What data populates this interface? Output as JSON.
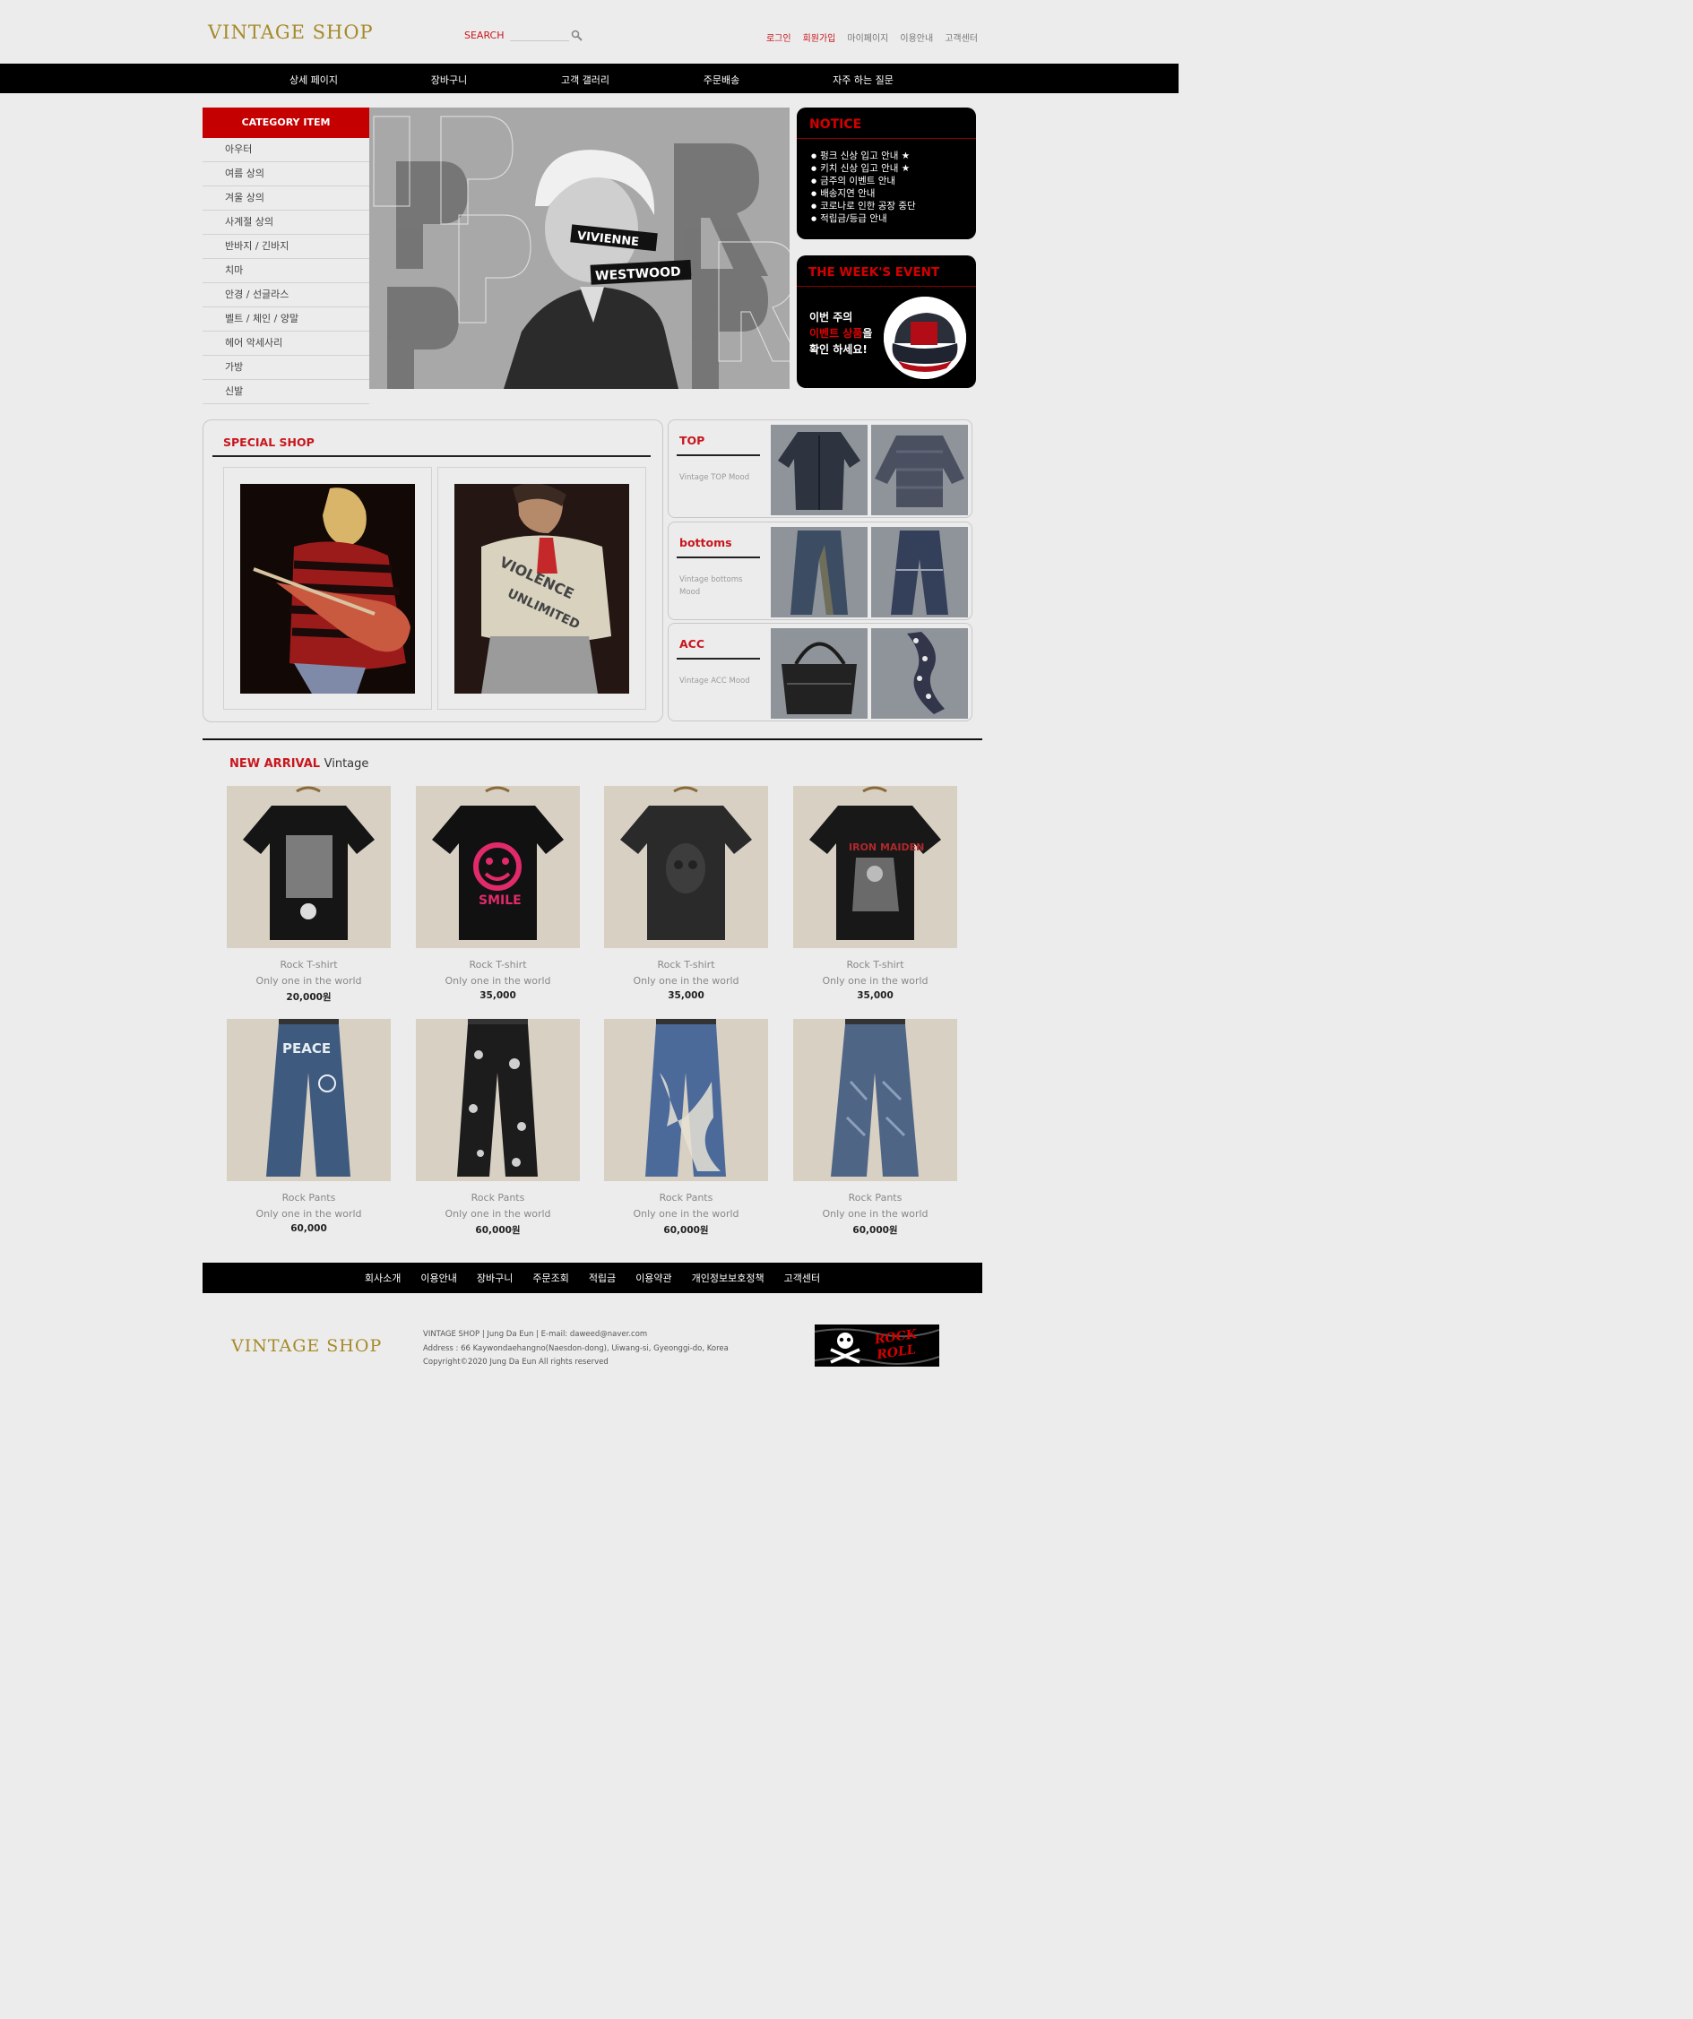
{
  "header": {
    "logo": "VINTAGE SHOP",
    "search_label": "SEARCH",
    "search_placeholder": "",
    "top_links": [
      {
        "label": "로그인"
      },
      {
        "label": "회원가입"
      },
      {
        "label": "마이페이지"
      },
      {
        "label": "이용안내"
      },
      {
        "label": "고객센터"
      }
    ]
  },
  "nav": [
    "상세 페이지",
    "장바구니",
    "고객 갤러리",
    "주문배송",
    "자주 하는 질문"
  ],
  "category": {
    "title": "CATEGORY ITEM",
    "items": [
      "아우터",
      "여름 상의",
      "겨울 상의",
      "사계절 상의",
      "반바지 / 긴바지",
      "치마",
      "안경 / 선글라스",
      "벨트 / 체인 / 양말",
      "헤어 악세사리",
      "가방",
      "신발"
    ]
  },
  "notice": {
    "title": "NOTICE",
    "items": [
      "펑크 신상 입고 안내 ★",
      "키치 신상 입고 안내 ★",
      "금주의 이벤트 안내",
      "배송지연 안내",
      "코로나로 인한 공장 중단",
      "적립금/등급 안내"
    ]
  },
  "event": {
    "title": "THE WEEK'S EVENT",
    "line1": "이번 주의",
    "line2": "이벤트 상품",
    "line2_suffix": "을",
    "line3": "확인 하세요!"
  },
  "special": {
    "title": "SPECIAL SHOP"
  },
  "category_boxes": [
    {
      "title": "TOP",
      "sub": "Vintage TOP Mood"
    },
    {
      "title": "bottoms",
      "sub": "Vintage bottoms Mood"
    },
    {
      "title": "ACC",
      "sub": "Vintage ACC Mood"
    }
  ],
  "new_arrival": {
    "title_red": "NEW ARRIVAL",
    "title_rest": "Vintage",
    "products": [
      {
        "name": "Rock T-shirt",
        "desc": "Only one in the world",
        "price": "20,000원",
        "icon": "tshirt-band-print"
      },
      {
        "name": "Rock T-shirt",
        "desc": "Only one in the world",
        "price": "35,000",
        "icon": "tshirt-smile-print"
      },
      {
        "name": "Rock T-shirt",
        "desc": "Only one in the world",
        "price": "35,000",
        "icon": "tshirt-skull-print"
      },
      {
        "name": "Rock T-shirt",
        "desc": "Only one in the world",
        "price": "35,000",
        "icon": "tshirt-iron-maiden-print"
      },
      {
        "name": "Rock Pants",
        "desc": "Only one in the world",
        "price": "60,000",
        "icon": "jeans-peace-print"
      },
      {
        "name": "Rock Pants",
        "desc": "Only one in the world",
        "price": "60,000원",
        "icon": "pants-floral-print"
      },
      {
        "name": "Rock Pants",
        "desc": "Only one in the world",
        "price": "60,000원",
        "icon": "jeans-bleached"
      },
      {
        "name": "Rock Pants",
        "desc": "Only one in the world",
        "price": "60,000원",
        "icon": "jeans-biker"
      }
    ]
  },
  "footer": {
    "links": [
      "회사소개",
      "이용안내",
      "장바구니",
      "주문조회",
      "적립금",
      "이용약관",
      "개인정보보호정책",
      "고객센터"
    ],
    "logo": "VINTAGE SHOP",
    "info_line1": "VINTAGE SHOP  |  Jung Da Eun  |  E-mail: daweed@naver.com",
    "info_line2": "Address : 66 Kaywondaehangno(Naesdon-dong), Uiwang-si, Gyeonggi-do, Korea",
    "info_line3": "Copyright©2020  Jung Da Eun  All rights reserved",
    "badge_text": "ROCK ROLL"
  },
  "colors": {
    "accent": "#c8161d",
    "nav_bg": "#000000",
    "page_bg": "#ececec",
    "logo_gold": "#a68a2a"
  }
}
